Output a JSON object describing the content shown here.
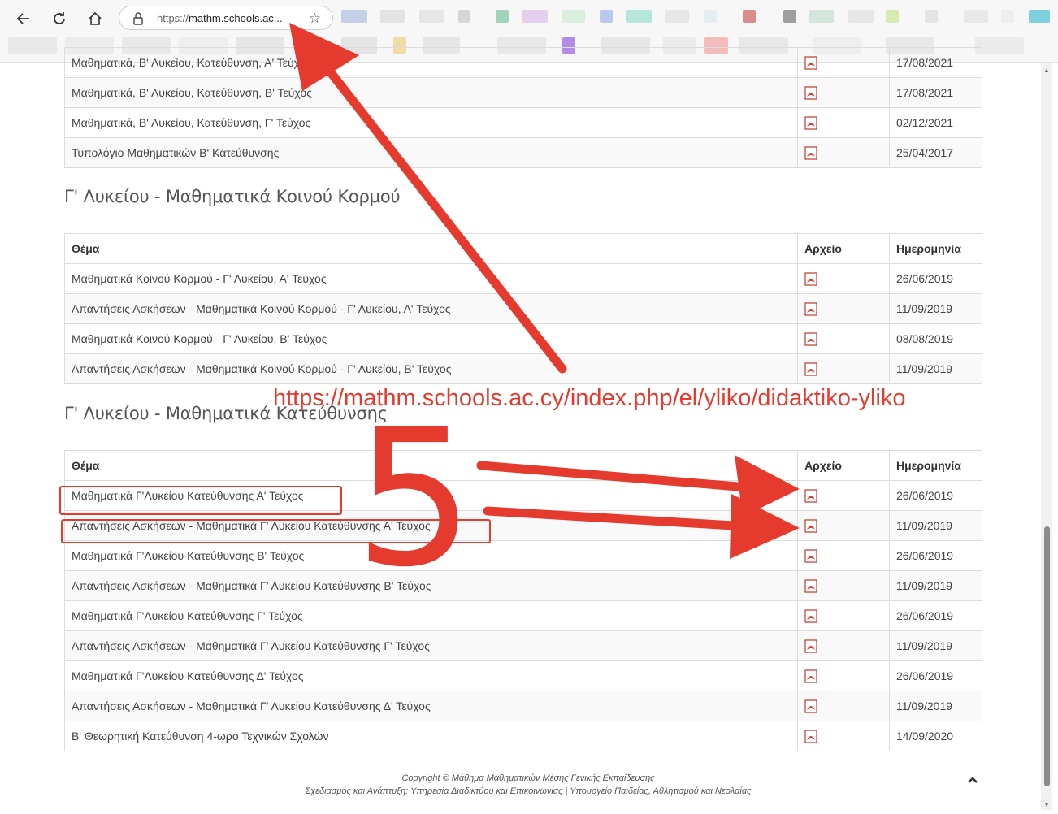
{
  "browser": {
    "url_prefix": "https://",
    "url_host": "mathm.schools.ac...",
    "back_icon": "arrow-left-icon",
    "reload_icon": "reload-icon",
    "home_icon": "home-icon",
    "favorite_icon": "star-icon",
    "lock_icon": "lock-icon"
  },
  "table1": {
    "rows": [
      {
        "topic": "Μαθηματικά, Β' Λυκείου, Κατεύθυνση, Α' Τεύχος",
        "date": "17/08/2021"
      },
      {
        "topic": "Μαθηματικά, Β' Λυκείου, Κατεύθυνση, Β' Τεύχος",
        "date": "17/08/2021"
      },
      {
        "topic": "Μαθηματικά, Β' Λυκείου, Κατεύθυνση, Γ' Τεύχος",
        "date": "02/12/2021"
      },
      {
        "topic": "Τυπολόγιο Μαθηματικών Β' Κατεύθυνσης",
        "date": "25/04/2017"
      }
    ]
  },
  "section2": {
    "title": "Γ' Λυκείου - Μαθηματικά Κοινού Κορμού",
    "headers": {
      "topic": "Θέμα",
      "file": "Αρχείο",
      "date": "Ημερομηνία"
    },
    "rows": [
      {
        "topic": "Μαθηματικά Κοινού Κορμού - Γ' Λυκείου, Α' Τεύχος",
        "date": "26/06/2019"
      },
      {
        "topic": "Απαντήσεις Ασκήσεων - Μαθηματικά Κοινού Κορμού - Γ' Λυκείου, Α' Τεύχος",
        "date": "11/09/2019"
      },
      {
        "topic": "Μαθηματικά Κοινού Κορμού - Γ' Λυκείου, Β' Τεύχος",
        "date": "08/08/2019"
      },
      {
        "topic": "Απαντήσεις Ασκήσεων - Μαθηματικά Κοινού Κορμού - Γ' Λυκείου, Β' Τεύχος",
        "date": "11/09/2019"
      }
    ]
  },
  "section3": {
    "title": "Γ' Λυκείου - Μαθηματικά Κατεύθυνσης",
    "headers": {
      "topic": "Θέμα",
      "file": "Αρχείο",
      "date": "Ημερομηνία"
    },
    "rows": [
      {
        "topic": "Μαθηματικά Γ'Λυκείου Κατεύθυνσης Α' Τεύχος",
        "date": "26/06/2019"
      },
      {
        "topic": "Απαντήσεις Ασκήσεων - Μαθηματικά Γ' Λυκείου Κατεύθυνσης Α' Τεύχος",
        "date": "11/09/2019"
      },
      {
        "topic": "Μαθηματικά Γ'Λυκείου Κατεύθυνσης Β' Τεύχος",
        "date": "26/06/2019"
      },
      {
        "topic": "Απαντήσεις Ασκήσεων - Μαθηματικά Γ' Λυκείου Κατεύθυνσης Β' Τεύχος",
        "date": "11/09/2019"
      },
      {
        "topic": "Μαθηματικά Γ'Λυκείου Κατεύθυνσης Γ' Τεύχος",
        "date": "26/06/2019"
      },
      {
        "topic": "Απαντήσεις Ασκήσεων - Μαθηματικά Γ' Λυκείου Κατεύθυνσης Γ' Τεύχος",
        "date": "11/09/2019"
      },
      {
        "topic": "Μαθηματικά Γ'Λυκείου Κατεύθυνσης Δ' Τεύχος",
        "date": "26/06/2019"
      },
      {
        "topic": "Απαντήσεις Ασκήσεων - Μαθηματικά Γ' Λυκείου Κατεύθυνσης Δ' Τεύχος",
        "date": "11/09/2019"
      },
      {
        "topic": "Β' Θεωρητική Κατεύθυνση 4-ωρο Τεχνικών Σχολών",
        "date": "14/09/2020"
      }
    ]
  },
  "footer": {
    "line1": "Copyright © Μάθημα Μαθηματικών Μέσης Γενικής Εκπαίδευσης",
    "line2": "Σχεδιασμός και Ανάπτυξη: Υπηρεσία Διαδικτύου και Επικοινωνίας | Υπουργείο Παιδείας, Αθλητισμού και Νεολαίας"
  },
  "annotation": {
    "url_text": "https://mathm.schools.ac.cy/index.php/el/yliko/didaktiko-yliko",
    "step_number": "5",
    "color": "#e53b2f"
  },
  "colors": {
    "accent_red": "#e53b2f",
    "border": "#dcdcdc"
  }
}
